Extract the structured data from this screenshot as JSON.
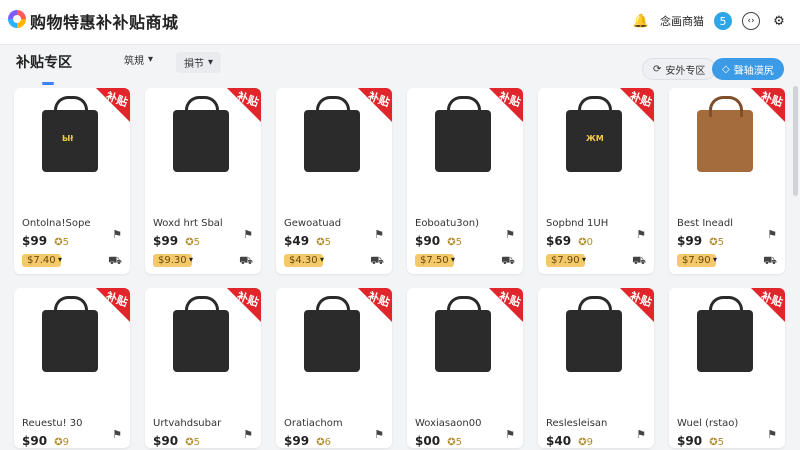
{
  "header": {
    "title": "购物特惠补补贴商城",
    "action_label": "念画商猫",
    "badge": "5"
  },
  "toolbar": {
    "section_title": "补贴专区",
    "filter1": "筑規",
    "filter2": "損节",
    "btn_light": "安外专区",
    "btn_blue": "聲轴漠尻"
  },
  "ribbon_text": "补贴",
  "row1": [
    {
      "name": "Ontolna!Sope",
      "price": "$99",
      "coin": "5",
      "sub": "$7.40",
      "bag": "black",
      "tag": "Ыł"
    },
    {
      "name": "Woxd hrt Sbal",
      "price": "$99",
      "coin": "5",
      "sub": "$9.30",
      "bag": "black",
      "tag": ""
    },
    {
      "name": "Gewoatuad",
      "price": "$49",
      "coin": "5",
      "sub": "$4.30",
      "bag": "black",
      "tag": ""
    },
    {
      "name": "Eoboatu3on)",
      "price": "$90",
      "coin": "5",
      "sub": "$7.50",
      "bag": "black",
      "tag": ""
    },
    {
      "name": "Sopbnd 1UH",
      "price": "$69",
      "coin": "0",
      "sub": "$7.90",
      "bag": "black",
      "tag": "ЖΜ"
    },
    {
      "name": "Best Ineadl",
      "price": "$99",
      "coin": "5",
      "sub": "$7.90",
      "bag": "brown",
      "tag": ""
    }
  ],
  "row2": [
    {
      "name": "Reuestu! 30",
      "price": "$90",
      "coin": "9",
      "bag": "black"
    },
    {
      "name": "Urtvahdsubar",
      "price": "$90",
      "coin": "5",
      "bag": "black"
    },
    {
      "name": "Oratiachom",
      "price": "$99",
      "coin": "6",
      "bag": "black"
    },
    {
      "name": "Woxiasaon00",
      "price": "$00",
      "coin": "5",
      "bag": "black"
    },
    {
      "name": "Reslesleisan",
      "price": "$40",
      "coin": "9",
      "bag": "black"
    },
    {
      "name": "Wuel (rstao)",
      "price": "$90",
      "coin": "5",
      "bag": "black"
    }
  ]
}
